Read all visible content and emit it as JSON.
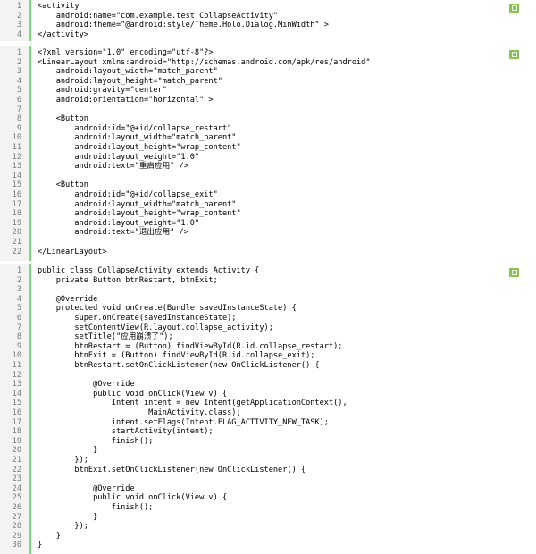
{
  "blocks": [
    {
      "name": "manifest-xml",
      "lines": [
        {
          "n": "1",
          "t": "<activity"
        },
        {
          "n": "2",
          "t": "    android:name=\"com.example.test.CollapseActivity\""
        },
        {
          "n": "3",
          "t": "    android:theme=\"@android:style/Theme.Holo.Dialog.MinWidth\" >"
        },
        {
          "n": "4",
          "t": "</activity>"
        }
      ]
    },
    {
      "name": "layout-xml",
      "lines": [
        {
          "n": "1",
          "t": "<?xml version=\"1.0\" encoding=\"utf-8\"?>"
        },
        {
          "n": "2",
          "t": "<LinearLayout xmlns:android=\"http://schemas.android.com/apk/res/android\""
        },
        {
          "n": "3",
          "t": "    android:layout_width=\"match_parent\""
        },
        {
          "n": "4",
          "t": "    android:layout_height=\"match_parent\""
        },
        {
          "n": "5",
          "t": "    android:gravity=\"center\""
        },
        {
          "n": "6",
          "t": "    android:orientation=\"horizontal\" >"
        },
        {
          "n": "7",
          "t": ""
        },
        {
          "n": "8",
          "t": "    <Button"
        },
        {
          "n": "9",
          "t": "        android:id=\"@+id/collapse_restart\""
        },
        {
          "n": "10",
          "t": "        android:layout_width=\"match_parent\""
        },
        {
          "n": "11",
          "t": "        android:layout_height=\"wrap_content\""
        },
        {
          "n": "12",
          "t": "        android:layout_weight=\"1.0\""
        },
        {
          "n": "13",
          "t": "        android:text=\"重启应用\" />"
        },
        {
          "n": "14",
          "t": ""
        },
        {
          "n": "15",
          "t": "    <Button"
        },
        {
          "n": "16",
          "t": "        android:id=\"@+id/collapse_exit\""
        },
        {
          "n": "17",
          "t": "        android:layout_width=\"match_parent\""
        },
        {
          "n": "18",
          "t": "        android:layout_height=\"wrap_content\""
        },
        {
          "n": "19",
          "t": "        android:layout_weight=\"1.0\""
        },
        {
          "n": "20",
          "t": "        android:text=\"退出应用\" />"
        },
        {
          "n": "21",
          "t": ""
        },
        {
          "n": "22",
          "t": "</LinearLayout>"
        }
      ]
    },
    {
      "name": "java-source",
      "lines": [
        {
          "n": "1",
          "t": "public class CollapseActivity extends Activity {"
        },
        {
          "n": "2",
          "t": "    private Button btnRestart, btnExit;"
        },
        {
          "n": "3",
          "t": ""
        },
        {
          "n": "4",
          "t": "    @Override"
        },
        {
          "n": "5",
          "t": "    protected void onCreate(Bundle savedInstanceState) {"
        },
        {
          "n": "6",
          "t": "        super.onCreate(savedInstanceState);"
        },
        {
          "n": "7",
          "t": "        setContentView(R.layout.collapse_activity);"
        },
        {
          "n": "8",
          "t": "        setTitle(\"应用崩溃了\");"
        },
        {
          "n": "9",
          "t": "        btnRestart = (Button) findViewById(R.id.collapse_restart);"
        },
        {
          "n": "10",
          "t": "        btnExit = (Button) findViewById(R.id.collapse_exit);"
        },
        {
          "n": "11",
          "t": "        btnRestart.setOnClickListener(new OnClickListener() {"
        },
        {
          "n": "12",
          "t": ""
        },
        {
          "n": "13",
          "t": "            @Override"
        },
        {
          "n": "14",
          "t": "            public void onClick(View v) {"
        },
        {
          "n": "15",
          "t": "                Intent intent = new Intent(getApplicationContext(),"
        },
        {
          "n": "16",
          "t": "                        MainActivity.class);"
        },
        {
          "n": "17",
          "t": "                intent.setFlags(Intent.FLAG_ACTIVITY_NEW_TASK);"
        },
        {
          "n": "18",
          "t": "                startActivity(intent);"
        },
        {
          "n": "19",
          "t": "                finish();"
        },
        {
          "n": "20",
          "t": "            }"
        },
        {
          "n": "21",
          "t": "        });"
        },
        {
          "n": "22",
          "t": "        btnExit.setOnClickListener(new OnClickListener() {"
        },
        {
          "n": "23",
          "t": ""
        },
        {
          "n": "24",
          "t": "            @Override"
        },
        {
          "n": "25",
          "t": "            public void onClick(View v) {"
        },
        {
          "n": "26",
          "t": "                finish();"
        },
        {
          "n": "27",
          "t": "            }"
        },
        {
          "n": "28",
          "t": "        });"
        },
        {
          "n": "29",
          "t": "    }"
        },
        {
          "n": "30",
          "t": "}"
        }
      ]
    }
  ],
  "icons": {
    "copy": "copy-code-icon"
  },
  "colors": {
    "gutter_bar": "#6ce26c",
    "copy_button": "#8bc34a",
    "keyword": "#006699",
    "string": "#0000ff",
    "line_number": "#7a7a7a"
  }
}
